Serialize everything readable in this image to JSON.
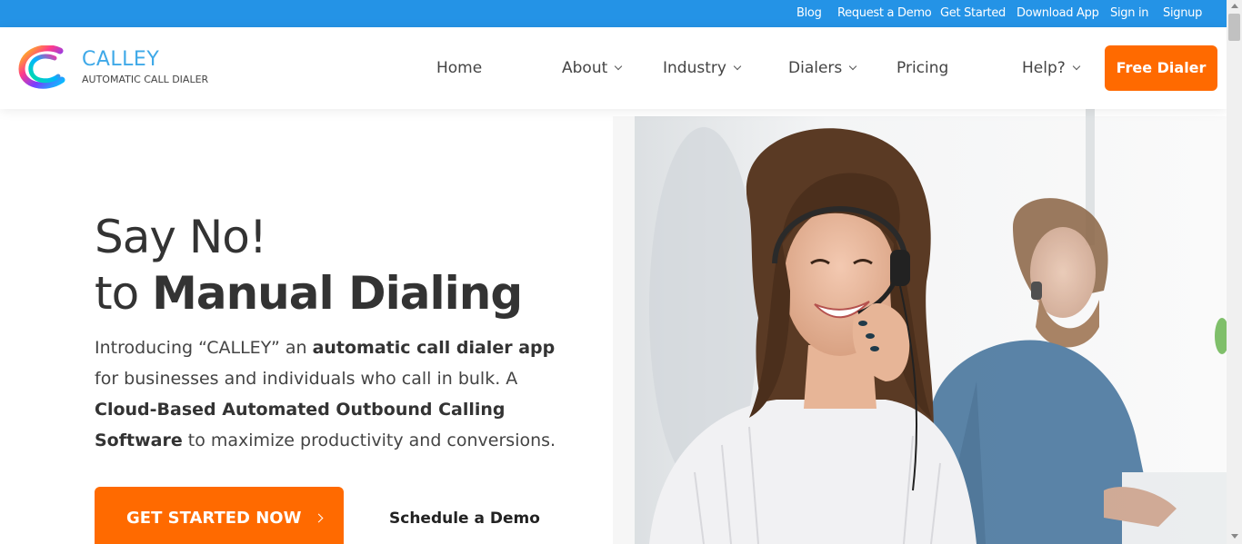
{
  "topbar": {
    "links": [
      "Blog",
      "Request a Demo",
      "Get Started",
      "Download App",
      "Sign in",
      "Signup"
    ]
  },
  "brand": {
    "name": "CALLEY",
    "tagline": "AUTOMATIC CALL DIALER",
    "colors": {
      "topbar": "#2493e6",
      "accent": "#ff6a00",
      "logo_text": "#3fa9e8"
    }
  },
  "nav": {
    "items": [
      {
        "label": "Home",
        "has_dropdown": false
      },
      {
        "label": "About",
        "has_dropdown": true
      },
      {
        "label": "Industry",
        "has_dropdown": true
      },
      {
        "label": "Dialers",
        "has_dropdown": true
      },
      {
        "label": "Pricing",
        "has_dropdown": false
      },
      {
        "label": "Help?",
        "has_dropdown": true
      }
    ],
    "cta_label": "Free Dialer"
  },
  "hero": {
    "line1": "Say No!",
    "line2_prefix": "to ",
    "line2_bold": "Manual Dialing",
    "intro": {
      "p1": "Introducing “CALLEY” an ",
      "b1": "automatic call dialer app",
      "p2": " for businesses and individuals who call in bulk. A ",
      "b2": "Cloud-Based Automated Outbound Calling Software",
      "p3": " to maximize productivity and conversions."
    },
    "primary_cta": "GET STARTED NOW",
    "secondary_cta": "Schedule a Demo"
  }
}
